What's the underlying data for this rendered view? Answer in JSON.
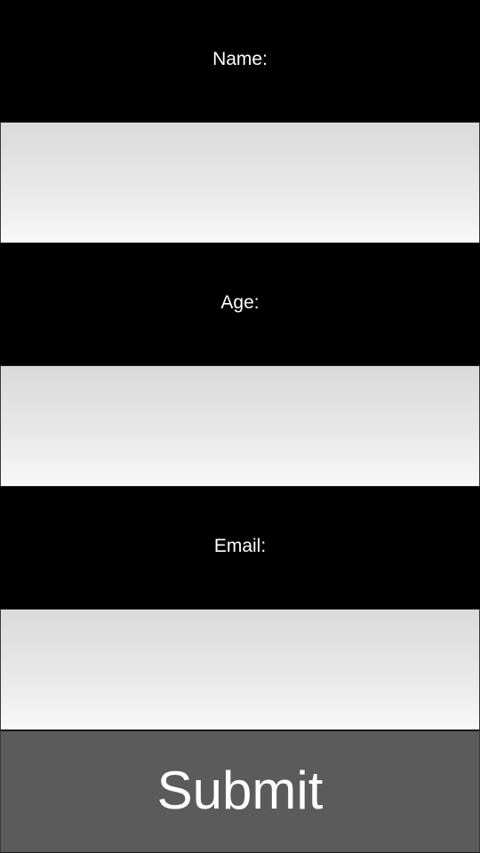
{
  "form": {
    "fields": [
      {
        "label": "Name:",
        "value": "",
        "placeholder": ""
      },
      {
        "label": "Age:",
        "value": "",
        "placeholder": ""
      },
      {
        "label": "Email:",
        "value": "",
        "placeholder": ""
      }
    ],
    "submit_label": "Submit"
  },
  "colors": {
    "background": "#000000",
    "label_text": "#ffffff",
    "input_gradient_top": "#dadada",
    "input_gradient_bottom": "#f8f8f8",
    "submit_background": "#5b5b5b",
    "submit_text": "#ffffff"
  }
}
